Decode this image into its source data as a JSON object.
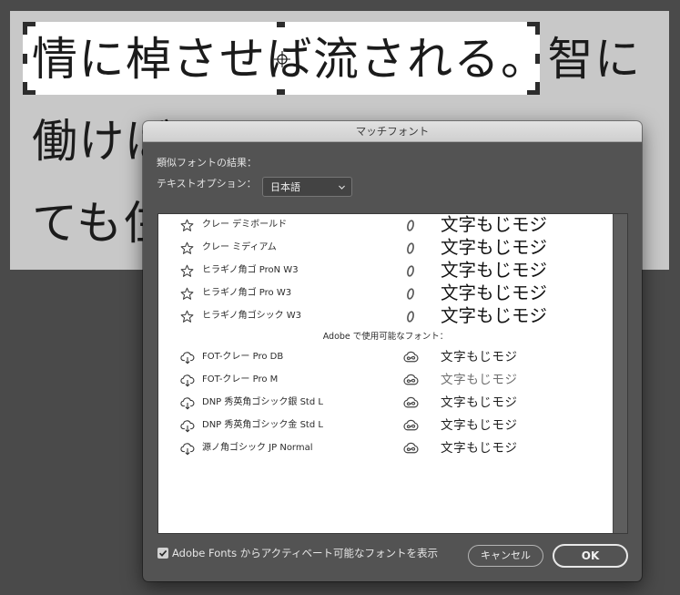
{
  "colors": {
    "page_bg": "#4a4a4a",
    "canvas_bg": "#c8c8c8",
    "selection_bg": "#ffffff",
    "dialog_bg": "#535353",
    "list_bg": "#ffffff"
  },
  "canvas": {
    "lines": [
      "情に棹させば流される。智に",
      "働けば",
      "ても住"
    ]
  },
  "dialog": {
    "title": "マッチフォント",
    "results_label": "類似フォントの結果：",
    "text_option": {
      "label": "テキストオプション：",
      "value": "日本語",
      "icon": "chevron-down-icon"
    },
    "installed_fonts": [
      {
        "name": "クレー デミボールド",
        "sample": "文字もじモジ",
        "icon": "star-icon",
        "format_icon": "opentype-icon"
      },
      {
        "name": "クレー ミディアム",
        "sample": "文字もじモジ",
        "icon": "star-icon",
        "format_icon": "opentype-icon"
      },
      {
        "name": "ヒラギノ角ゴ ProN W3",
        "sample": "文字もじモジ",
        "icon": "star-icon",
        "format_icon": "opentype-icon"
      },
      {
        "name": "ヒラギノ角ゴ Pro W3",
        "sample": "文字もじモジ",
        "icon": "star-icon",
        "format_icon": "opentype-icon"
      },
      {
        "name": "ヒラギノ角ゴシック W3",
        "sample": "文字もじモジ",
        "icon": "star-icon",
        "format_icon": "opentype-icon"
      }
    ],
    "adobe_fonts_header": "Adobe で使用可能なフォント：",
    "adobe_fonts": [
      {
        "name": "FOT-クレー Pro DB",
        "sample": "文字もじモジ",
        "icon": "cloud-download-icon",
        "format_icon": "creative-cloud-icon"
      },
      {
        "name": "FOT-クレー Pro M",
        "sample": "文字もじモジ",
        "icon": "cloud-download-icon",
        "format_icon": "creative-cloud-icon"
      },
      {
        "name": "DNP 秀英角ゴシック銀 Std L",
        "sample": "文字もじモジ",
        "icon": "cloud-download-icon",
        "format_icon": "creative-cloud-icon"
      },
      {
        "name": "DNP 秀英角ゴシック金 Std L",
        "sample": "文字もじモジ",
        "icon": "cloud-download-icon",
        "format_icon": "creative-cloud-icon"
      },
      {
        "name": "源ノ角ゴシック JP Normal",
        "sample": "文字もじモジ",
        "icon": "cloud-download-icon",
        "format_icon": "creative-cloud-icon"
      }
    ],
    "show_adobe_fonts": {
      "checked": true,
      "label": "Adobe Fonts からアクティベート可能なフォントを表示"
    },
    "buttons": {
      "cancel": "キャンセル",
      "ok": "OK"
    }
  }
}
